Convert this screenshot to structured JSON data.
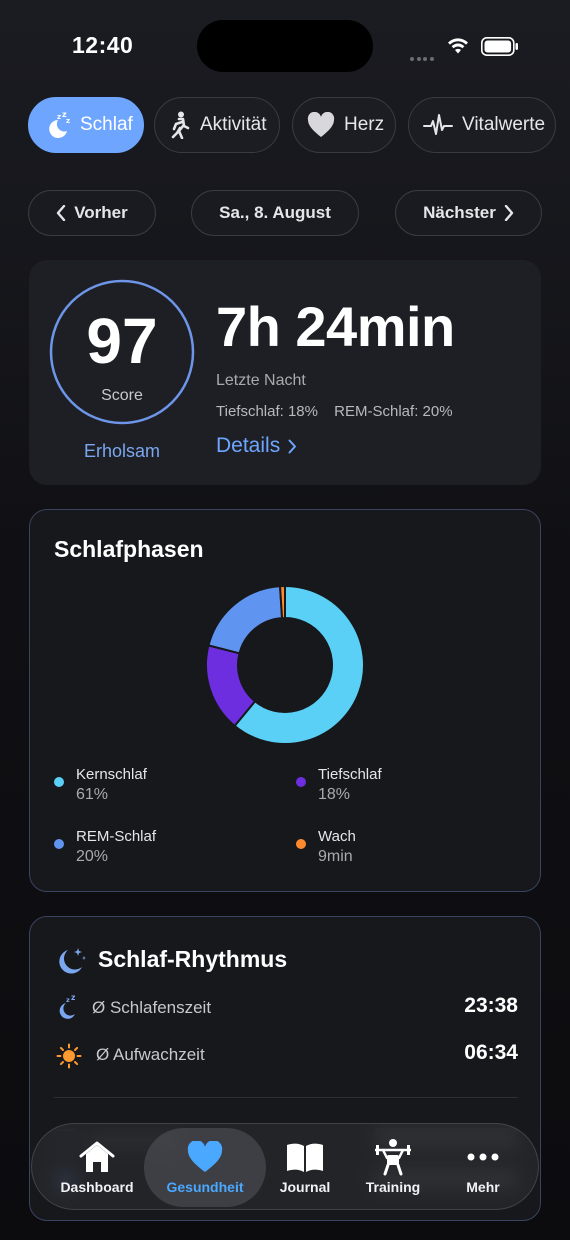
{
  "status_bar": {
    "time": "12:40"
  },
  "tabs": [
    {
      "label": "Schlaf",
      "icon": "sleep-icon",
      "active": true
    },
    {
      "label": "Aktivität",
      "icon": "walking-icon",
      "active": false
    },
    {
      "label": "Herz",
      "icon": "heart-icon",
      "active": false
    },
    {
      "label": "Vitalwerte",
      "icon": "waveform-icon",
      "active": false
    }
  ],
  "date_nav": {
    "prev": "Vorher",
    "date": "Sa., 8. August",
    "next": "Nächster"
  },
  "summary": {
    "score": "97",
    "score_label": "Score",
    "score_rating": "Erholsam",
    "duration": "7h 24min",
    "subtitle": "Letzte Nacht",
    "deep_sleep": "Tiefschlaf: 18%",
    "rem_sleep": "REM-Schlaf: 20%",
    "details_link": "Details"
  },
  "phases": {
    "title": "Schlafphasen",
    "legend": [
      {
        "name": "Kernschlaf",
        "value": "61%",
        "color": "#5ad0f7"
      },
      {
        "name": "Tiefschlaf",
        "value": "18%",
        "color": "#6d2ee0"
      },
      {
        "name": "REM-Schlaf",
        "value": "20%",
        "color": "#5f95f0"
      },
      {
        "name": "Wach",
        "value": "9min",
        "color": "#ff8a2e"
      }
    ]
  },
  "chart_data": {
    "type": "pie",
    "title": "Schlafphasen",
    "categories": [
      "Kernschlaf",
      "Tiefschlaf",
      "REM-Schlaf",
      "Wach"
    ],
    "values": [
      61,
      18,
      20,
      1
    ],
    "colors": [
      "#5ad0f7",
      "#6d2ee0",
      "#5f95f0",
      "#ff8a2e"
    ],
    "donut": true
  },
  "rhythm": {
    "title": "Schlaf-Rhythmus",
    "bedtime_label": "Ø Schlafenszeit",
    "bedtime_value": "23:38",
    "wake_label": "Ø Aufwachzeit",
    "wake_value": "06:34"
  },
  "tabbar": [
    {
      "label": "Dashboard",
      "icon": "house-icon",
      "active": false
    },
    {
      "label": "Gesundheit",
      "icon": "heart-icon",
      "active": true
    },
    {
      "label": "Journal",
      "icon": "book-icon",
      "active": false
    },
    {
      "label": "Training",
      "icon": "weightlifting-icon",
      "active": false
    },
    {
      "label": "Mehr",
      "icon": "more-dots-icon",
      "active": false
    }
  ],
  "colors": {
    "accent": "#6ea6ff",
    "active_tab_label": "#4aa8ff",
    "score_ring": "#6d95e8"
  }
}
